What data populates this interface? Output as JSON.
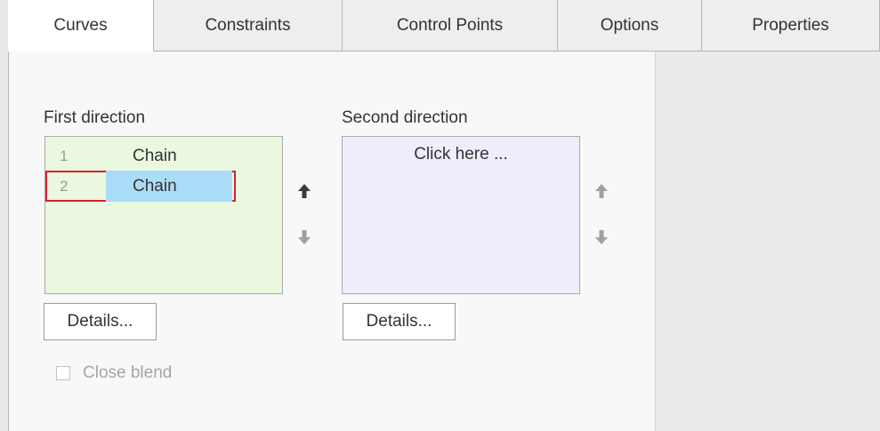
{
  "tabs": [
    {
      "label": "Curves",
      "active": true
    },
    {
      "label": "Constraints",
      "active": false
    },
    {
      "label": "Control Points",
      "active": false
    },
    {
      "label": "Options",
      "active": false
    },
    {
      "label": "Properties",
      "active": false
    }
  ],
  "first_direction": {
    "label": "First direction",
    "items": [
      {
        "index": "1",
        "name": "Chain",
        "selected": false
      },
      {
        "index": "2",
        "name": "Chain",
        "selected": true
      }
    ],
    "details_label": "Details..."
  },
  "second_direction": {
    "label": "Second direction",
    "placeholder": "Click here ...",
    "details_label": "Details..."
  },
  "close_blend": {
    "label": "Close blend",
    "checked": false,
    "enabled": false
  },
  "colors": {
    "first_list_bg": "#eaf8e0",
    "second_list_bg": "#efedfb",
    "selection": "#a9ddf7",
    "highlight_border": "#d9202f"
  },
  "icons": {
    "move_up": "arrow-up-icon",
    "move_down": "arrow-down-icon"
  }
}
